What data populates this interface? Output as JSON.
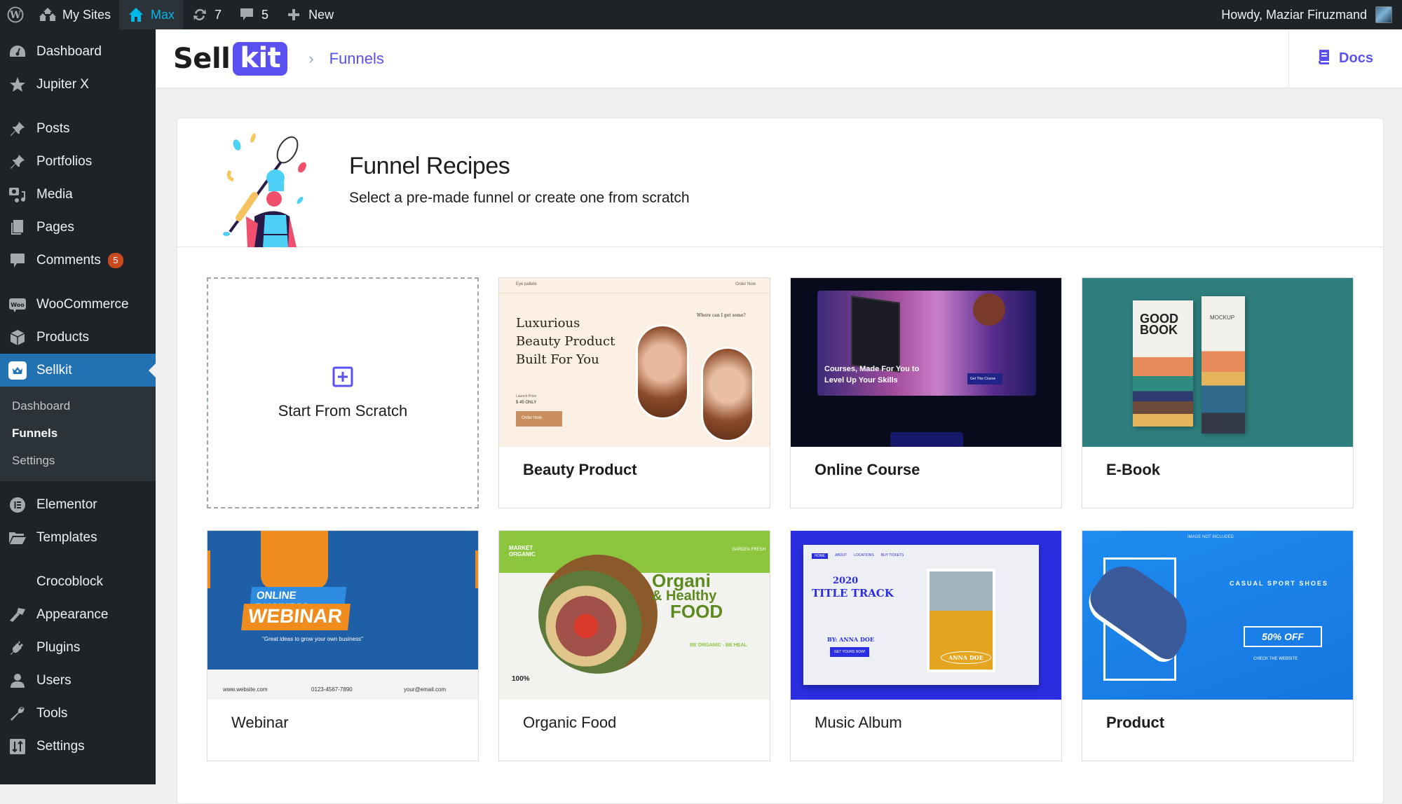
{
  "admin_bar": {
    "wp_logo": "wordpress-icon",
    "my_sites": "My Sites",
    "site": "Max",
    "updates_count": "7",
    "comments_count": "5",
    "new_label": "New",
    "greeting": "Howdy, Maziar Firuzmand"
  },
  "sidebar": {
    "items": [
      {
        "label": "Dashboard",
        "icon": "dashboard-icon"
      },
      {
        "label": "Jupiter X",
        "icon": "star-icon"
      },
      {
        "label": "Posts",
        "icon": "pin-icon"
      },
      {
        "label": "Portfolios",
        "icon": "pin-icon"
      },
      {
        "label": "Media",
        "icon": "media-icon"
      },
      {
        "label": "Pages",
        "icon": "pages-icon"
      },
      {
        "label": "Comments",
        "icon": "comment-icon",
        "badge": "5"
      },
      {
        "label": "WooCommerce",
        "icon": "woo-icon"
      },
      {
        "label": "Products",
        "icon": "box-icon"
      },
      {
        "label": "Sellkit",
        "icon": "sellkit-icon",
        "current": true
      },
      {
        "label": "Elementor",
        "icon": "elementor-icon"
      },
      {
        "label": "Templates",
        "icon": "folder-icon"
      },
      {
        "label": "Crocoblock",
        "icon": "crocoblock-icon"
      },
      {
        "label": "Appearance",
        "icon": "brush-icon"
      },
      {
        "label": "Plugins",
        "icon": "plug-icon"
      },
      {
        "label": "Users",
        "icon": "user-icon"
      },
      {
        "label": "Tools",
        "icon": "wrench-icon"
      },
      {
        "label": "Settings",
        "icon": "settings-icon"
      }
    ],
    "submenu": [
      {
        "label": "Dashboard"
      },
      {
        "label": "Funnels",
        "current": true
      },
      {
        "label": "Settings"
      }
    ]
  },
  "header": {
    "logo_part1": "Sell",
    "logo_part2": "kit",
    "breadcrumb": "Funnels",
    "docs_label": "Docs"
  },
  "hero": {
    "title": "Funnel Recipes",
    "subtitle": "Select a pre-made funnel or create one from scratch"
  },
  "cards": {
    "scratch": "Start From Scratch",
    "items": [
      {
        "title": "Beauty Product",
        "thumb": {
          "heading": [
            "Luxurious",
            "Beauty Product",
            "Built For You"
          ],
          "brand": "Eye pallete",
          "nav": "Order Now",
          "price_label": "Launch Price",
          "price": "$ 45 ONLY",
          "button": "Order Now",
          "aside_title": "Where can I get some?"
        }
      },
      {
        "title": "Online Course",
        "thumb": {
          "heading": [
            "Courses, Made For You to",
            "Level Up Your Skills"
          ],
          "button": "Get This Course"
        }
      },
      {
        "title": "E-Book",
        "thumb": {
          "cover": [
            "GOOD",
            "BOOK"
          ],
          "side": "MOCKUP"
        }
      },
      {
        "title": "Webinar",
        "thumb": {
          "top": "ONLINE BUSINESS",
          "main": "WEBINAR",
          "tagline": "\"Great ideas to grow your own business\"",
          "website": "www.website.com",
          "phone": "0123-4567-7890",
          "email": "your@email.com"
        }
      },
      {
        "title": "Organic Food",
        "thumb": {
          "brand": [
            "MARKET",
            "ORGANIC"
          ],
          "tag": "GARDEN FRESH",
          "heading": [
            "Organi",
            "& Healthy",
            "FOOD"
          ],
          "slogan": "BE ORGANIC - BE HEAL",
          "badge": "100%"
        }
      },
      {
        "title": "Music Album",
        "thumb": {
          "nav": [
            "HOME",
            "ABOUT",
            "LOCATIONS",
            "BUY TICKETS"
          ],
          "year": "2020",
          "heading": "TITLE TRACK",
          "by": "BY: ANNA DOE",
          "button": "GET YOURS NOW!",
          "name": "ANNA DOE"
        }
      },
      {
        "title": "Product",
        "thumb": {
          "note": "IMAGE NOT INCLUDED",
          "heading": "CASUAL SPORT SHOES",
          "offer": "50% OFF",
          "cta": "CHECK THE WEBSITE"
        }
      }
    ]
  },
  "colors": {
    "brand": "#5a50f0",
    "admin_bg": "#1d2327",
    "menu_current": "#2271b1",
    "badge": "#ca4a1f"
  }
}
